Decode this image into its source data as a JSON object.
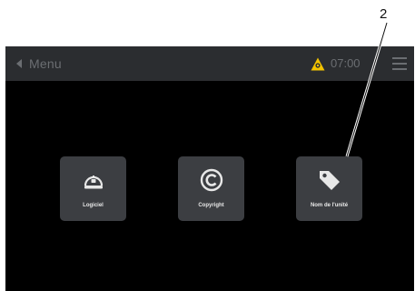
{
  "topbar": {
    "back_label": "Menu",
    "time": "07:00"
  },
  "tiles": [
    {
      "label": "Logiciel",
      "icon": "software-icon"
    },
    {
      "label": "Copyright",
      "icon": "copyright-icon"
    },
    {
      "label": "Nom de l'unité",
      "icon": "tag-icon"
    }
  ],
  "callout": {
    "number": "2"
  },
  "colors": {
    "background": "#000000",
    "topbar": "#2b2d30",
    "tile": "#3c3e42",
    "warning": "#f2c200"
  }
}
